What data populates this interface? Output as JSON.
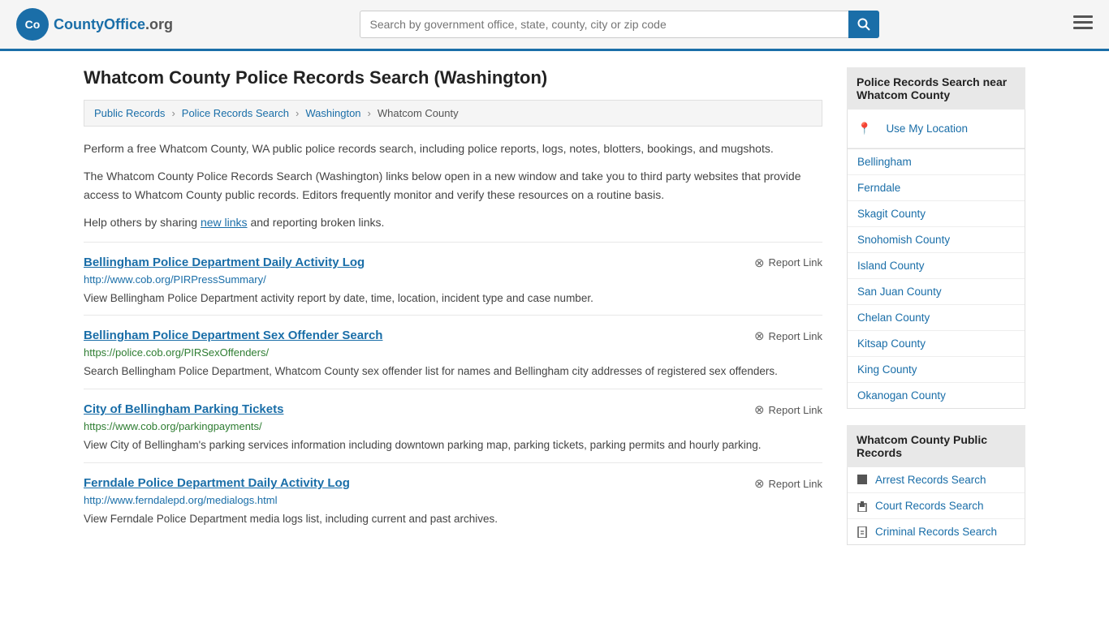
{
  "header": {
    "logo_text": "CountyOffice",
    "logo_suffix": ".org",
    "search_placeholder": "Search by government office, state, county, city or zip code",
    "search_btn_label": "🔍"
  },
  "page": {
    "title": "Whatcom County Police Records Search (Washington)",
    "description1": "Perform a free Whatcom County, WA public police records search, including police reports, logs, notes, blotters, bookings, and mugshots.",
    "description2": "The Whatcom County Police Records Search (Washington) links below open in a new window and take you to third party websites that provide access to Whatcom County public records. Editors frequently monitor and verify these resources on a routine basis.",
    "description3_before": "Help others by sharing ",
    "description3_link": "new links",
    "description3_after": " and reporting broken links."
  },
  "breadcrumb": {
    "items": [
      {
        "label": "Public Records",
        "href": "#"
      },
      {
        "label": "Police Records Search",
        "href": "#"
      },
      {
        "label": "Washington",
        "href": "#"
      },
      {
        "label": "Whatcom County",
        "href": "#"
      }
    ]
  },
  "results": [
    {
      "title": "Bellingham Police Department Daily Activity Log",
      "url": "http://www.cob.org/PIRPressSummary/",
      "url_color": "blue",
      "description": "View Bellingham Police Department activity report by date, time, location, incident type and case number.",
      "report_label": "Report Link"
    },
    {
      "title": "Bellingham Police Department Sex Offender Search",
      "url": "https://police.cob.org/PIRSexOffenders/",
      "url_color": "green",
      "description": "Search Bellingham Police Department, Whatcom County sex offender list for names and Bellingham city addresses of registered sex offenders.",
      "report_label": "Report Link"
    },
    {
      "title": "City of Bellingham Parking Tickets",
      "url": "https://www.cob.org/parkingpayments/",
      "url_color": "green",
      "description": "View City of Bellingham's parking services information including downtown parking map, parking tickets, parking permits and hourly parking.",
      "report_label": "Report Link"
    },
    {
      "title": "Ferndale Police Department Daily Activity Log",
      "url": "http://www.ferndalepd.org/medialogs.html",
      "url_color": "blue",
      "description": "View Ferndale Police Department media logs list, including current and past archives.",
      "report_label": "Report Link"
    }
  ],
  "sidebar": {
    "nearby_header": "Police Records Search near Whatcom County",
    "use_location_label": "Use My Location",
    "nearby_links": [
      {
        "label": "Bellingham",
        "href": "#"
      },
      {
        "label": "Ferndale",
        "href": "#"
      },
      {
        "label": "Skagit County",
        "href": "#"
      },
      {
        "label": "Snohomish County",
        "href": "#"
      },
      {
        "label": "Island County",
        "href": "#"
      },
      {
        "label": "San Juan County",
        "href": "#"
      },
      {
        "label": "Chelan County",
        "href": "#"
      },
      {
        "label": "Kitsap County",
        "href": "#"
      },
      {
        "label": "King County",
        "href": "#"
      },
      {
        "label": "Okanogan County",
        "href": "#"
      }
    ],
    "public_records_header": "Whatcom County Public Records",
    "public_records_links": [
      {
        "label": "Arrest Records Search",
        "icon": "square",
        "href": "#"
      },
      {
        "label": "Court Records Search",
        "icon": "building",
        "href": "#"
      },
      {
        "label": "Criminal Records Search",
        "icon": "info",
        "href": "#"
      }
    ]
  }
}
